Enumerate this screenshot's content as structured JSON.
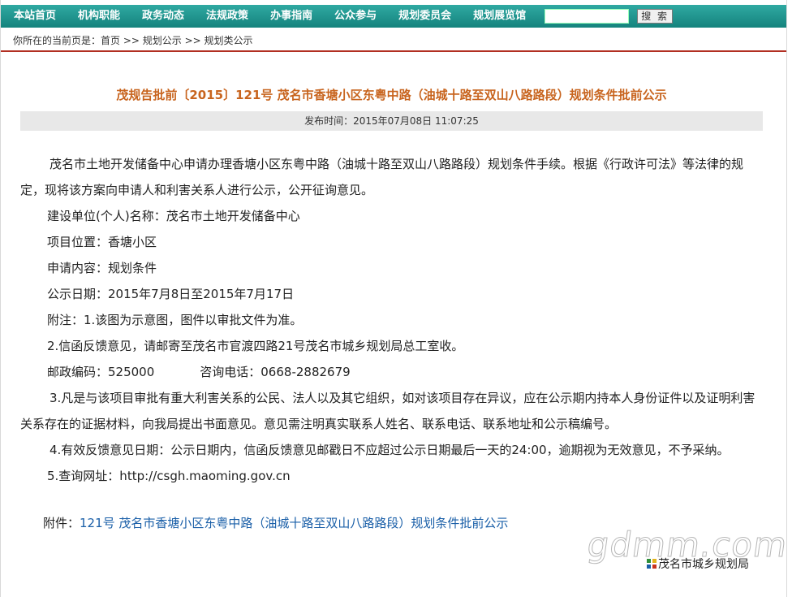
{
  "nav": {
    "items": [
      "本站首页",
      "机构职能",
      "政务动态",
      "法规政策",
      "办事指南",
      "公众参与",
      "规划委员会",
      "规划展览馆"
    ],
    "search_placeholder": "",
    "search_button": "搜 索"
  },
  "breadcrumb": {
    "prefix": "你所在的当前页是：",
    "home": "首页",
    "sep1": " >> ",
    "section": "规划公示",
    "sep2": " >> ",
    "current": "规划类公示"
  },
  "article": {
    "title": "茂规告批前〔2015〕121号 茂名市香塘小区东粤中路（油城十路至双山八路路段）规划条件批前公示",
    "publish_time": "发布时间：2015年07月08日 11:07:25",
    "intro": "茂名市土地开发储备中心申请办理香塘小区东粤中路（油城十路至双山八路路段）规划条件手续。根据《行政许可法》等法律的规定，现将该方案向申请人和利害关系人进行公示，公开征询意见。",
    "builder": "建设单位(个人)名称：茂名市土地开发储备中心",
    "location": "项目位置：香塘小区",
    "content": "申请内容：规划条件",
    "period": "公示日期：2015年7月8日至2015年7月17日",
    "note1": "附注：1.该图为示意图，图件以审批文件为准。",
    "note2": "2.信函反馈意见，请邮寄至茂名市官渡四路21号茂名市城乡规划局总工室收。",
    "postcode": "邮政编码：525000",
    "phone": "咨询电话：0668-2882679",
    "note3": "3.凡是与该项目审批有重大利害关系的公民、法人以及其它组织，如对该项目存在异议，应在公示期内持本人身份证件以及证明利害关系存在的证据材料，向我局提出书面意见。意见需注明真实联系人姓名、联系电话、联系地址和公示稿编号。",
    "note4": "4.有效反馈意见日期：公示日期内，信函反馈意见邮戳日不应超过公示日期最后一天的24:00，逾期视为无效意见，不予采纳。",
    "note5": "5.查询网址：http://csgh.maoming.gov.cn",
    "attachment_label": "附件：",
    "attachment_link": "121号 茂名市香塘小区东粤中路（油城十路至双山八路路段）规划条件批前公示"
  },
  "watermark": {
    "logo_text": "gdmm.com",
    "org": "茂名市城乡规划局"
  },
  "colors": {
    "nav_bg": "#1f968f",
    "title": "#c8641e",
    "link": "#1a5fa8",
    "breadcrumb_rule": "#b22f22"
  }
}
